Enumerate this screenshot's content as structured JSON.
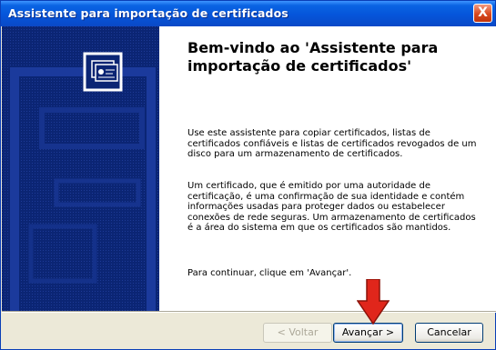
{
  "window": {
    "title": "Assistente para importação de certificados"
  },
  "close_label": "X",
  "heading": "Bem-vindo ao 'Assistente para importação de certificados'",
  "paragraphs": {
    "intro": "Use este assistente para copiar certificados, listas de certificados confiáveis e listas de certificados revogados de um disco para um armazenamento de certificados.",
    "definition": "Um certificado, que é emitido por uma autoridade de certificação, é uma confirmação de sua identidade e contém informações usadas para proteger dados ou estabelecer conexões de rede seguras. Um armazenamento de certificados é a área do sistema em que os certificados são mantidos.",
    "continue": "Para continuar, clique em 'Avançar'."
  },
  "buttons": {
    "back": "< Voltar",
    "next": "Avançar >",
    "cancel": "Cancelar"
  },
  "colors": {
    "titlebar": "#0555da",
    "side_panel": "#0b2574",
    "arrow": "#e0261b"
  },
  "icons": {
    "side_panel": "certificate-icon",
    "overlay": "red-down-arrow"
  }
}
